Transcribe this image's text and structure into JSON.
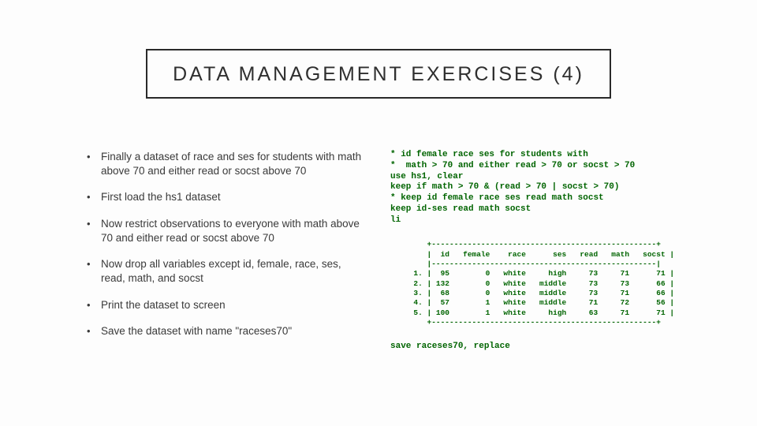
{
  "title": "DATA MANAGEMENT EXERCISES (4)",
  "bullets": [
    "Finally a dataset of race and ses for students with math above 70 and either read or socst above 70",
    "First load the hs1 dataset",
    "Now restrict observations to everyone with math above 70 and either read or socst above 70",
    "Now drop all variables except id, female, race, ses, read, math, and socst",
    "Print the dataset to screen",
    "Save the dataset with name  \"raceses70\""
  ],
  "code": {
    "l1": "* id female race ses for students with",
    "l2": "*  math > 70 and either read > 70 or socst > 70",
    "l3": "use hs1, clear",
    "l4": "keep if math > 70 & (read > 70 | socst > 70)",
    "l5": "* keep id female race ses read math socst",
    "l6": "keep id-ses read math socst",
    "l7": "li"
  },
  "table": {
    "border_top": "     +--------------------------------------------------+",
    "header": "     |  id   female    race      ses   read   math   socst |",
    "sep": "     |--------------------------------------------------|",
    "rows": [
      "  1. |  95        0   white     high     73     71      71 |",
      "  2. | 132        0   white   middle     73     73      66 |",
      "  3. |  68        0   white   middle     73     71      66 |",
      "  4. |  57        1   white   middle     71     72      56 |",
      "  5. | 100        1   white     high     63     71      71 |"
    ],
    "border_bot": "     +--------------------------------------------------+"
  },
  "save_line": "save raceses70, replace"
}
